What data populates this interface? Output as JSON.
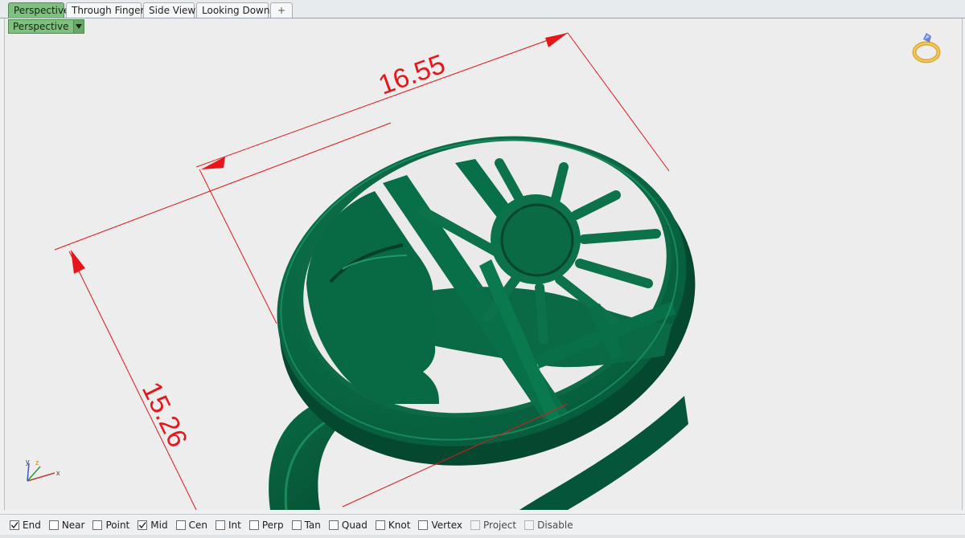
{
  "tabs": [
    {
      "label": "Perspective",
      "active": true
    },
    {
      "label": "Through Finger",
      "active": false
    },
    {
      "label": "Side View",
      "active": false
    },
    {
      "label": "Looking Down",
      "active": false
    }
  ],
  "tab_add_label": "+",
  "viewport": {
    "title": "Perspective",
    "dimensions": {
      "width_label": "16.55",
      "height_label": "15.26"
    },
    "axes": {
      "x": "x",
      "y": "y",
      "z": "z"
    }
  },
  "osnaps": [
    {
      "label": "End",
      "checked": true,
      "enabled": true
    },
    {
      "label": "Near",
      "checked": false,
      "enabled": true
    },
    {
      "label": "Point",
      "checked": false,
      "enabled": true
    },
    {
      "label": "Mid",
      "checked": true,
      "enabled": true
    },
    {
      "label": "Cen",
      "checked": false,
      "enabled": true
    },
    {
      "label": "Int",
      "checked": false,
      "enabled": true
    },
    {
      "label": "Perp",
      "checked": false,
      "enabled": true
    },
    {
      "label": "Tan",
      "checked": false,
      "enabled": true
    },
    {
      "label": "Quad",
      "checked": false,
      "enabled": true
    },
    {
      "label": "Knot",
      "checked": false,
      "enabled": true
    },
    {
      "label": "Vertex",
      "checked": false,
      "enabled": true
    },
    {
      "label": "Project",
      "checked": false,
      "enabled": false
    },
    {
      "label": "Disable",
      "checked": false,
      "enabled": false
    }
  ],
  "colors": {
    "active_tab": "#7fbf7f",
    "model": "#0b6b45",
    "dimension": "#e8161b",
    "viewport_bg": "#ededed"
  }
}
